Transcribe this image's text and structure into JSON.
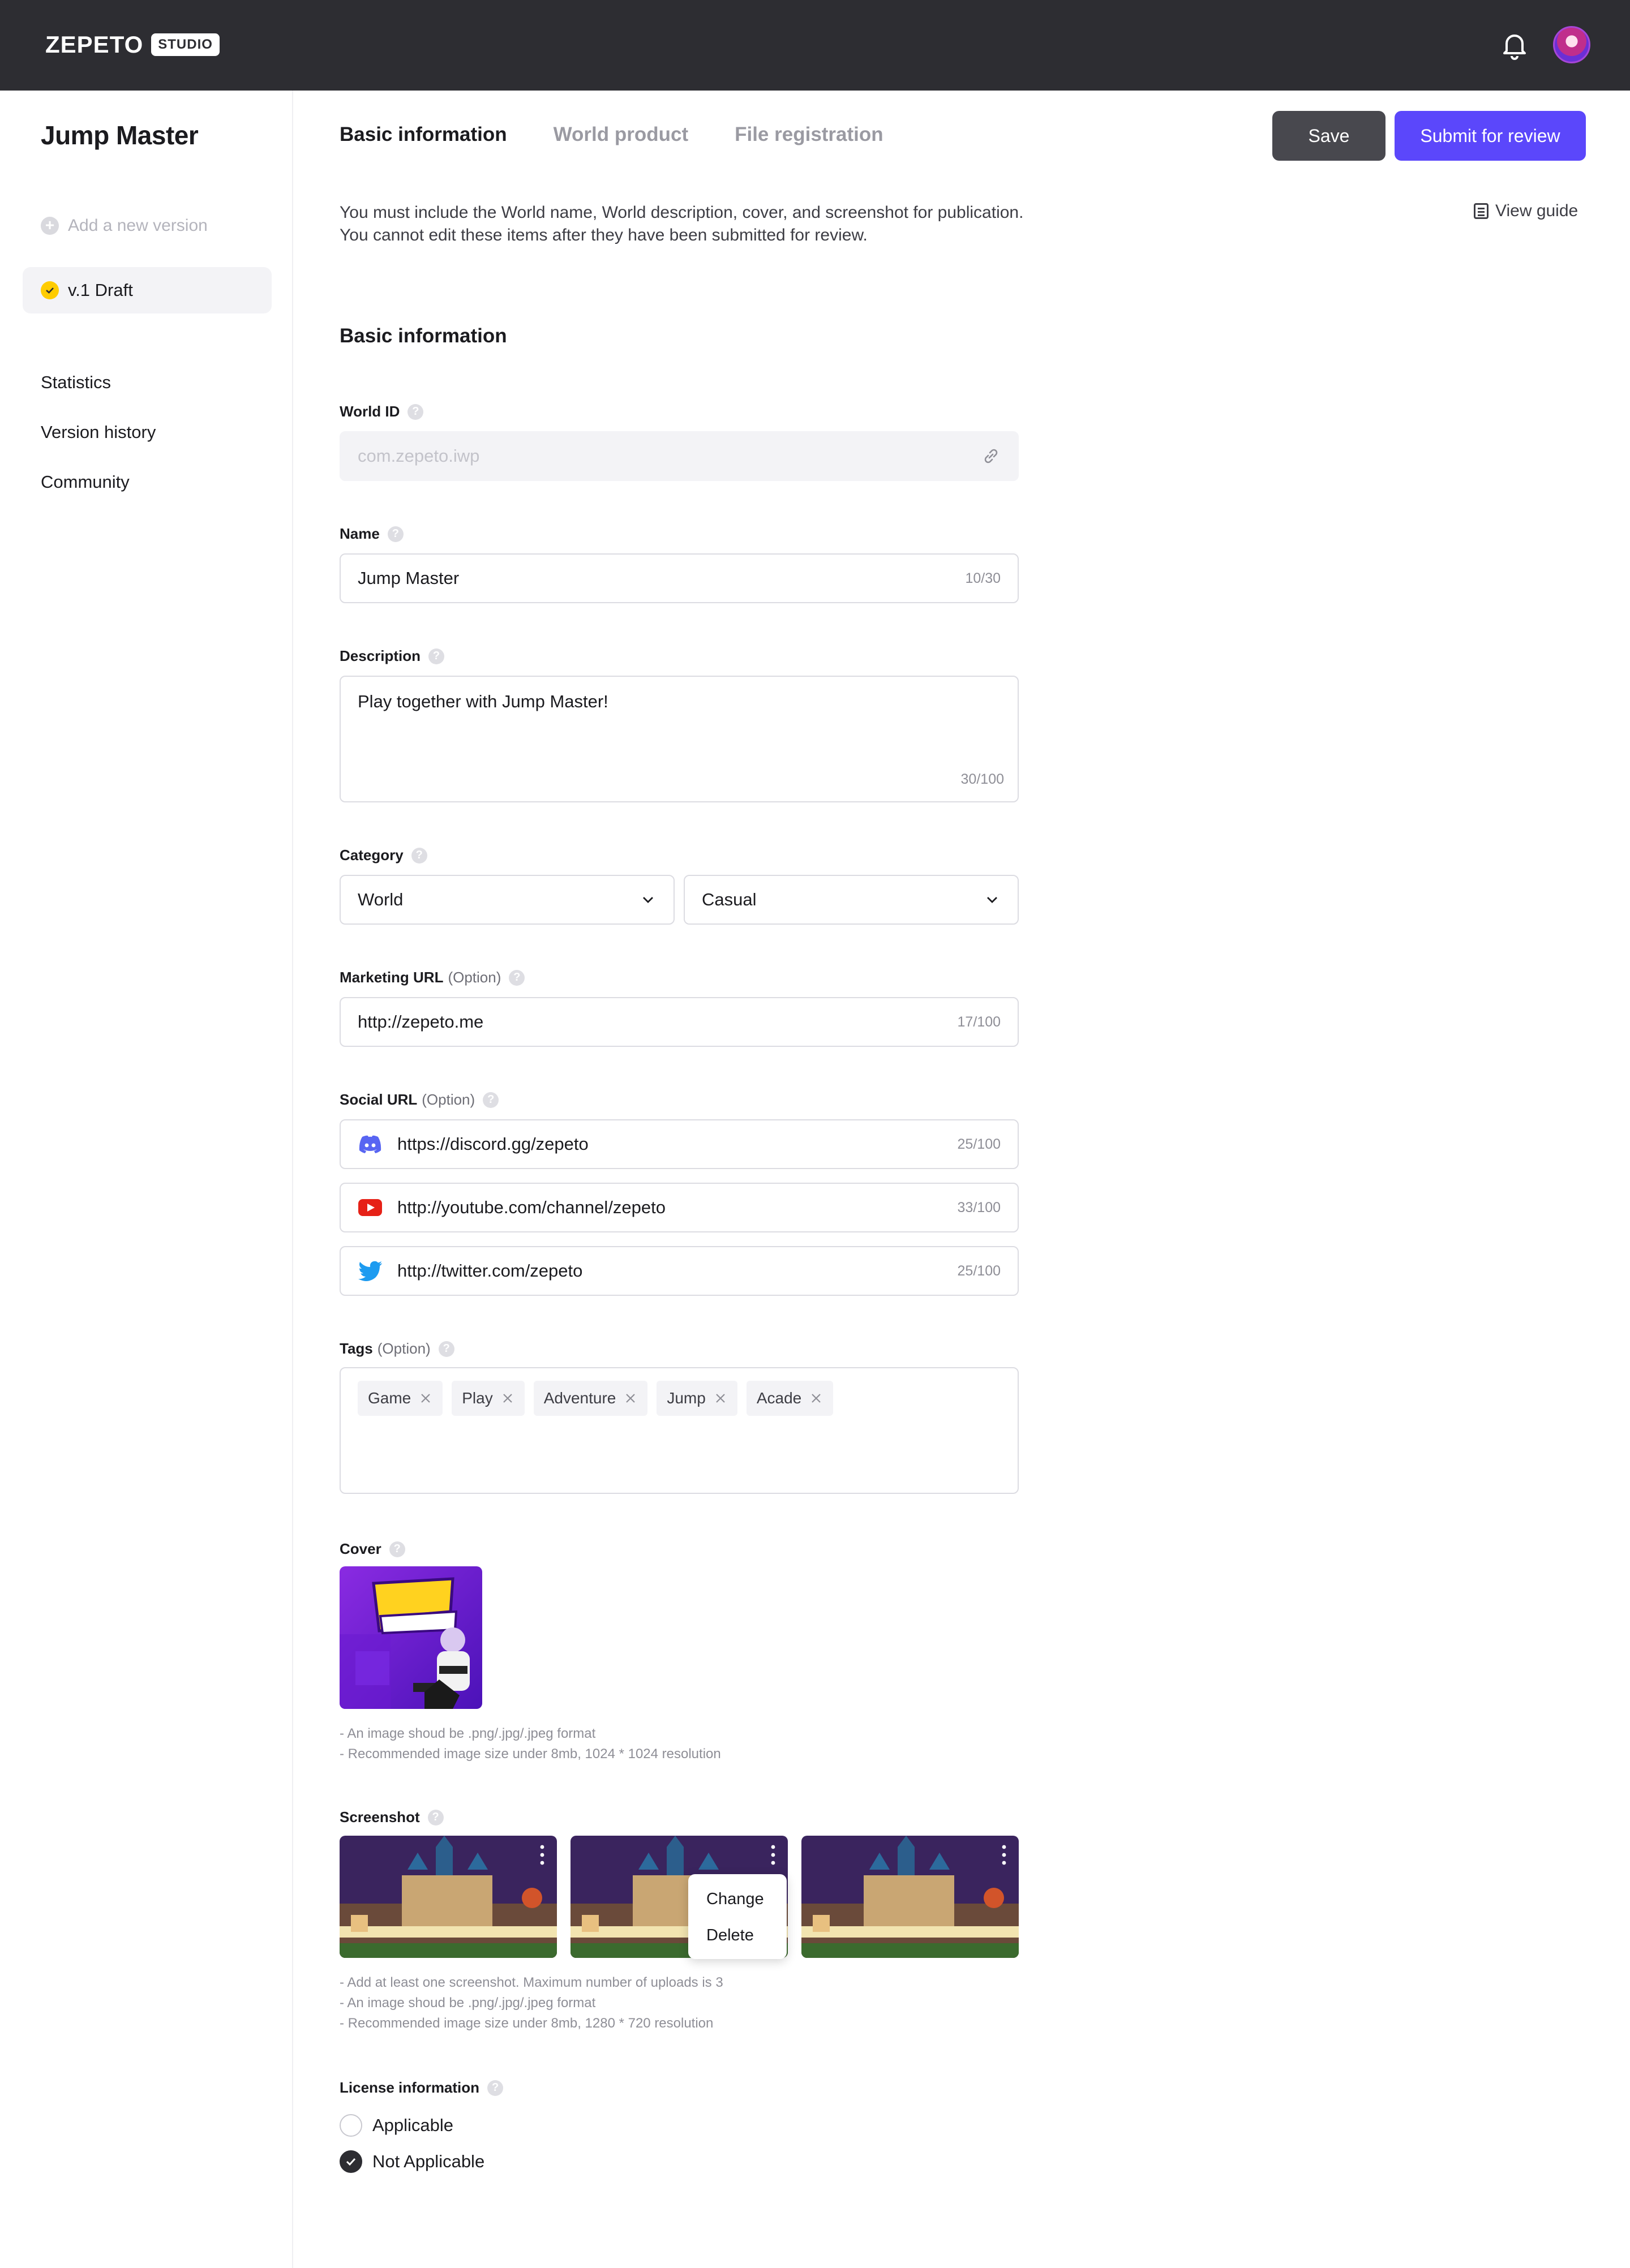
{
  "brand": {
    "logo": "ZEPETO",
    "badge": "STUDIO"
  },
  "header": {
    "notification_icon": "bell-icon",
    "avatar": "avatar"
  },
  "sidebar": {
    "project_title": "Jump Master",
    "add_version": "Add a new version",
    "current_version": "v.1 Draft",
    "nav": [
      "Statistics",
      "Version history",
      "Community"
    ]
  },
  "tabs": [
    "Basic information",
    "World product",
    "File registration"
  ],
  "actions": {
    "save": "Save",
    "submit": "Submit for review"
  },
  "notice": {
    "line1": "You must include the World name, World description, cover, and screenshot for publication.",
    "line2": "You cannot edit these items after they have been submitted for review.",
    "view_guide": "View guide"
  },
  "section_title": "Basic information",
  "form": {
    "world_id": {
      "label": "World ID",
      "placeholder": "com.zepeto.iwp"
    },
    "name": {
      "label": "Name",
      "value": "Jump Master",
      "count": "10/30"
    },
    "description": {
      "label": "Description",
      "value": "Play together with Jump Master!",
      "count": "30/100"
    },
    "category": {
      "label": "Category",
      "primary": "World",
      "secondary": "Casual"
    },
    "marketing_url": {
      "label": "Marketing URL",
      "option": "(Option)",
      "value": "http://zepeto.me",
      "count": "17/100"
    },
    "social_url": {
      "label": "Social URL",
      "option": "(Option)",
      "items": [
        {
          "icon": "discord-icon",
          "value": "https://discord.gg/zepeto",
          "count": "25/100"
        },
        {
          "icon": "youtube-icon",
          "value": "http://youtube.com/channel/zepeto",
          "count": "33/100"
        },
        {
          "icon": "twitter-icon",
          "value": "http://twitter.com/zepeto",
          "count": "25/100"
        }
      ]
    },
    "tags": {
      "label": "Tags",
      "option": "(Option)",
      "items": [
        "Game",
        "Play",
        "Adventure",
        "Jump",
        "Acade"
      ]
    },
    "cover": {
      "label": "Cover",
      "hint1": "- An image shoud be .png/.jpg/.jpeg format",
      "hint2": "- Recommended image size under 8mb, 1024 * 1024 resolution"
    },
    "screenshot": {
      "label": "Screenshot",
      "menu": [
        "Change",
        "Delete"
      ],
      "hint1": "- Add at least one screenshot. Maximum number of uploads is 3",
      "hint2": "- An image shoud be .png/.jpg/.jpeg format",
      "hint3": "- Recommended image size under 8mb, 1280 * 720 resolution"
    },
    "license": {
      "label": "License information",
      "options": [
        "Applicable",
        "Not Applicable"
      ],
      "selected": "Not Applicable"
    }
  },
  "colors": {
    "accent": "#5b47fb",
    "topbar": "#2d2d32",
    "draft": "#ffcc00"
  }
}
